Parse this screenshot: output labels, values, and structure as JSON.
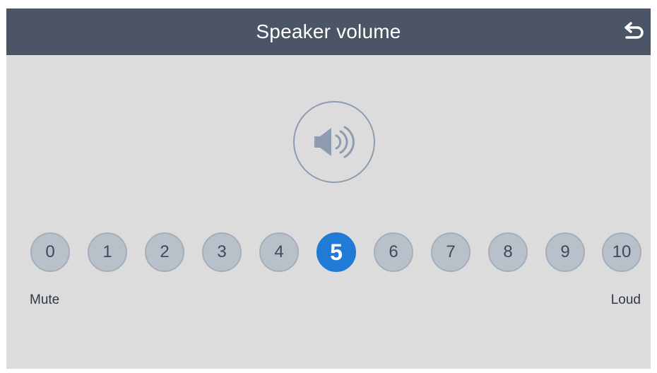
{
  "header": {
    "title": "Speaker volume",
    "back_icon": "undo-arrow-icon"
  },
  "speaker": {
    "icon": "speaker-volume-icon"
  },
  "volume": {
    "levels": [
      "0",
      "1",
      "2",
      "3",
      "4",
      "5",
      "6",
      "7",
      "8",
      "9",
      "10"
    ],
    "selected": "5",
    "min_label": "Mute",
    "max_label": "Loud"
  },
  "colors": {
    "header_bg": "#4b5565",
    "screen_bg": "#dcdcdc",
    "accent": "#1f7bd6",
    "level_bg": "#b8c0ca"
  }
}
